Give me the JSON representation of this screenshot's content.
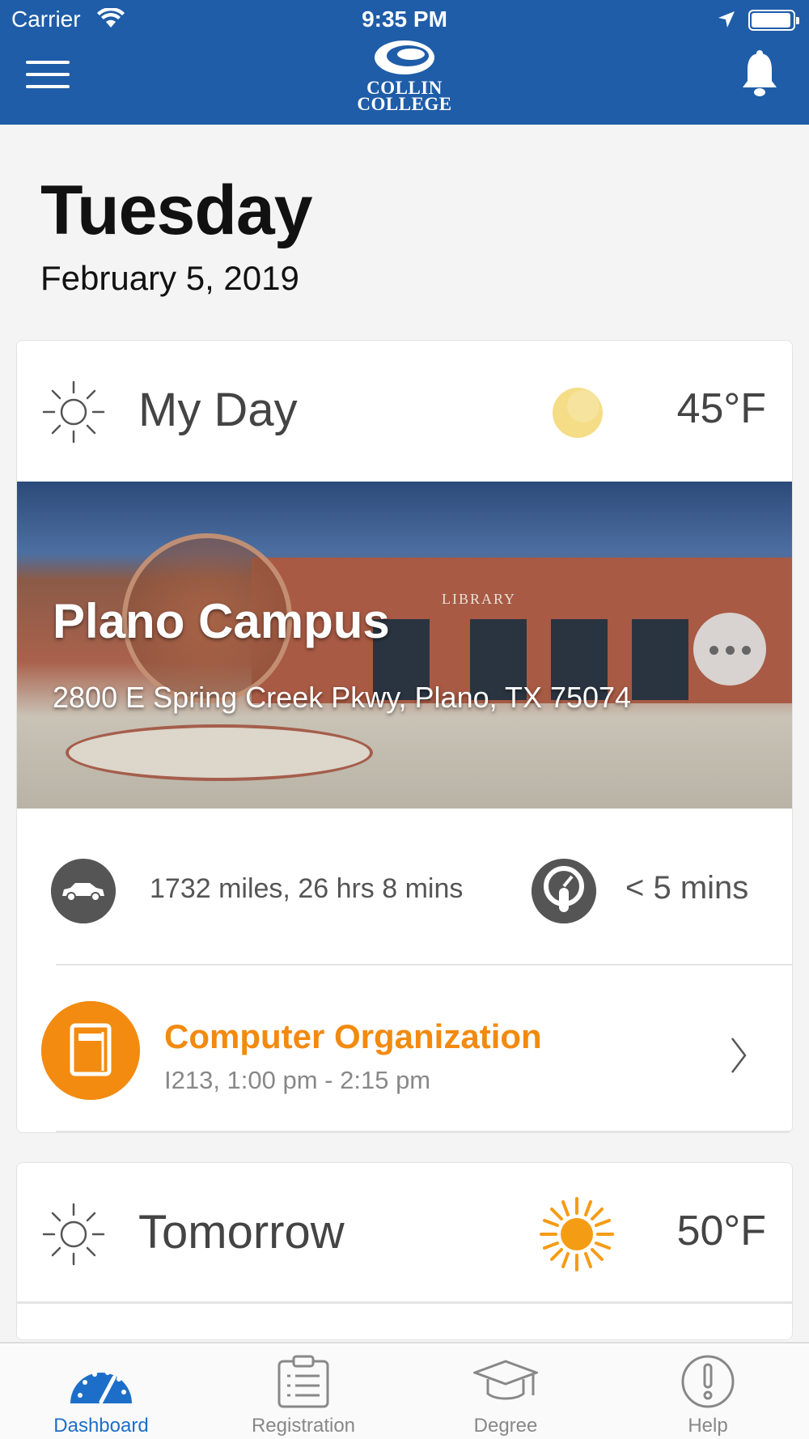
{
  "status_bar": {
    "carrier": "Carrier",
    "time": "9:35 PM"
  },
  "header": {
    "logo_line1": "COLLIN",
    "logo_line2": "COLLEGE",
    "brand_color": "#1f5da8"
  },
  "date": {
    "day": "Tuesday",
    "full_date": "February 5, 2019"
  },
  "my_day": {
    "title": "My Day",
    "temperature": "45°F",
    "weather_icon": "moon-icon",
    "campus": {
      "name": "Plano Campus",
      "address": "2800 E Spring Creek Pkwy, Plano, TX 75074",
      "building_sign": "LIBRARY"
    },
    "drive_info": "1732 miles, 26 hrs 8 mins",
    "walk_info": "< 5 mins",
    "class": {
      "title": "Computer Organization",
      "details": "I213, 1:00 pm - 2:15 pm",
      "accent_color": "#f28a10"
    }
  },
  "tomorrow": {
    "title": "Tomorrow",
    "temperature": "50°F",
    "weather_icon": "sun-icon"
  },
  "tabs": [
    {
      "label": "Dashboard",
      "icon": "speedometer-icon",
      "active": true
    },
    {
      "label": "Registration",
      "icon": "clipboard-icon",
      "active": false
    },
    {
      "label": "Degree",
      "icon": "graduation-cap-icon",
      "active": false
    },
    {
      "label": "Help",
      "icon": "exclamation-icon",
      "active": false
    }
  ]
}
